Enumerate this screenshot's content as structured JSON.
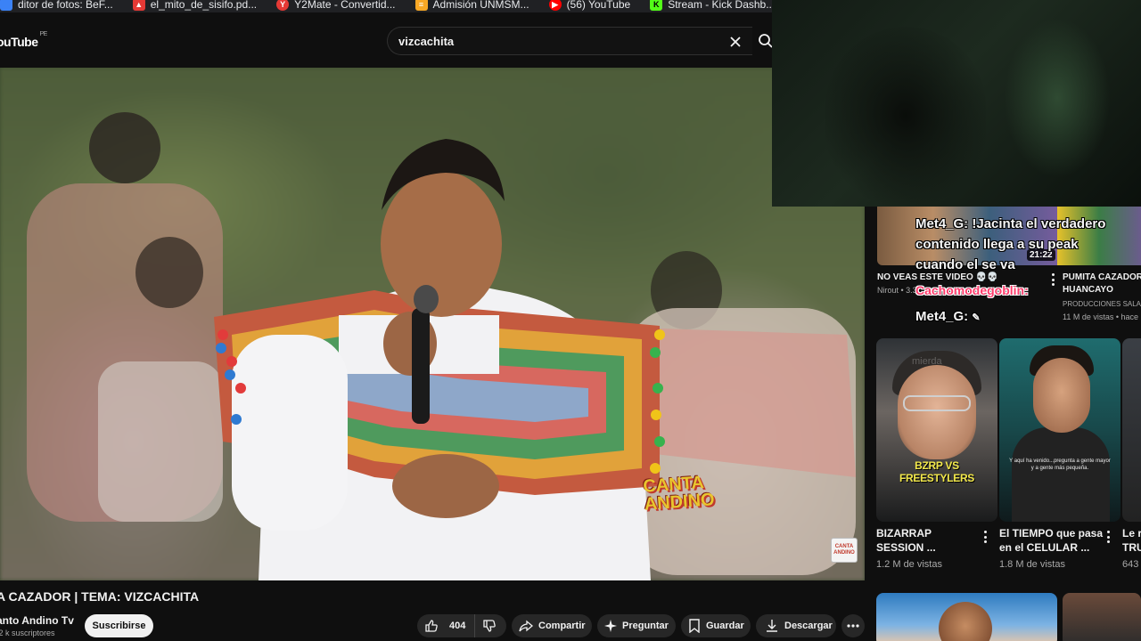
{
  "bookmarks": [
    {
      "label": "ditor de fotos: BeF...",
      "icon": "photo-editor-icon",
      "color": "#3b82f6"
    },
    {
      "label": "el_mito_de_sisifo.pd...",
      "icon": "pdf-icon",
      "color": "#e53935"
    },
    {
      "label": "Y2Mate - Convertid...",
      "icon": "y2mate-icon",
      "color": "#e53935"
    },
    {
      "label": "Admisión UNMSM...",
      "icon": "unmsm-icon",
      "color": "#f9a825"
    },
    {
      "label": "(56) YouTube",
      "icon": "youtube-icon",
      "color": "#ff0000"
    },
    {
      "label": "Stream - Kick Dashb...",
      "icon": "kick-icon",
      "color": "#53fc18"
    },
    {
      "label": "",
      "icon": "kick-icon",
      "color": "#53fc18"
    }
  ],
  "masthead": {
    "logo": "ouTube",
    "country": "PE",
    "search_value": "vizcachita"
  },
  "video": {
    "watermark_line1": "CANTA",
    "watermark_line2": "ANDINO",
    "title": "A CAZADOR | TEMA: VIZCACHITA",
    "channel": "anto Andino Tv",
    "subscribers": ".2 k suscriptores",
    "subscribe_label": "Suscribirse",
    "likes": "404",
    "share_label": "Compartir",
    "ask_label": "Preguntar",
    "save_label": "Guardar",
    "download_label": "Descargar"
  },
  "sidebar": {
    "top_row": [
      {
        "title": "NO VEAS ESTE VIDEO 💀💀",
        "meta": "Nirout • 3.3",
        "duration": "21:22"
      },
      {
        "title": "PUMITA CAZADOR",
        "title2": "HUANCAYO",
        "meta": "PRODUCCIONES SALA",
        "meta2": "11 M de vistas • hace"
      }
    ],
    "cards": [
      {
        "overlay": "BZRP VS FREESTYLERS",
        "title1": "BIZARRAP",
        "title2": "SESSION ...",
        "views": "1.2 M de vistas"
      },
      {
        "overlay": "Y aquí ha venido...pregunta a gente mayor y a gente más pequeña.",
        "title1": "El TIEMPO que pasa",
        "title2": "en el CELULAR ...",
        "views": "1.8 M de vistas"
      },
      {
        "title1": "Le r",
        "title2": "TRU",
        "views": "643"
      }
    ]
  },
  "chat_overlay": [
    {
      "user": "Met4_G:",
      "text": "!Jacinta el verdadero contenido llega a su peak cuando el se va"
    },
    {
      "user": "Cachomodegoblin:",
      "text": ""
    },
    {
      "user": "Met4_G:",
      "text": ""
    }
  ]
}
